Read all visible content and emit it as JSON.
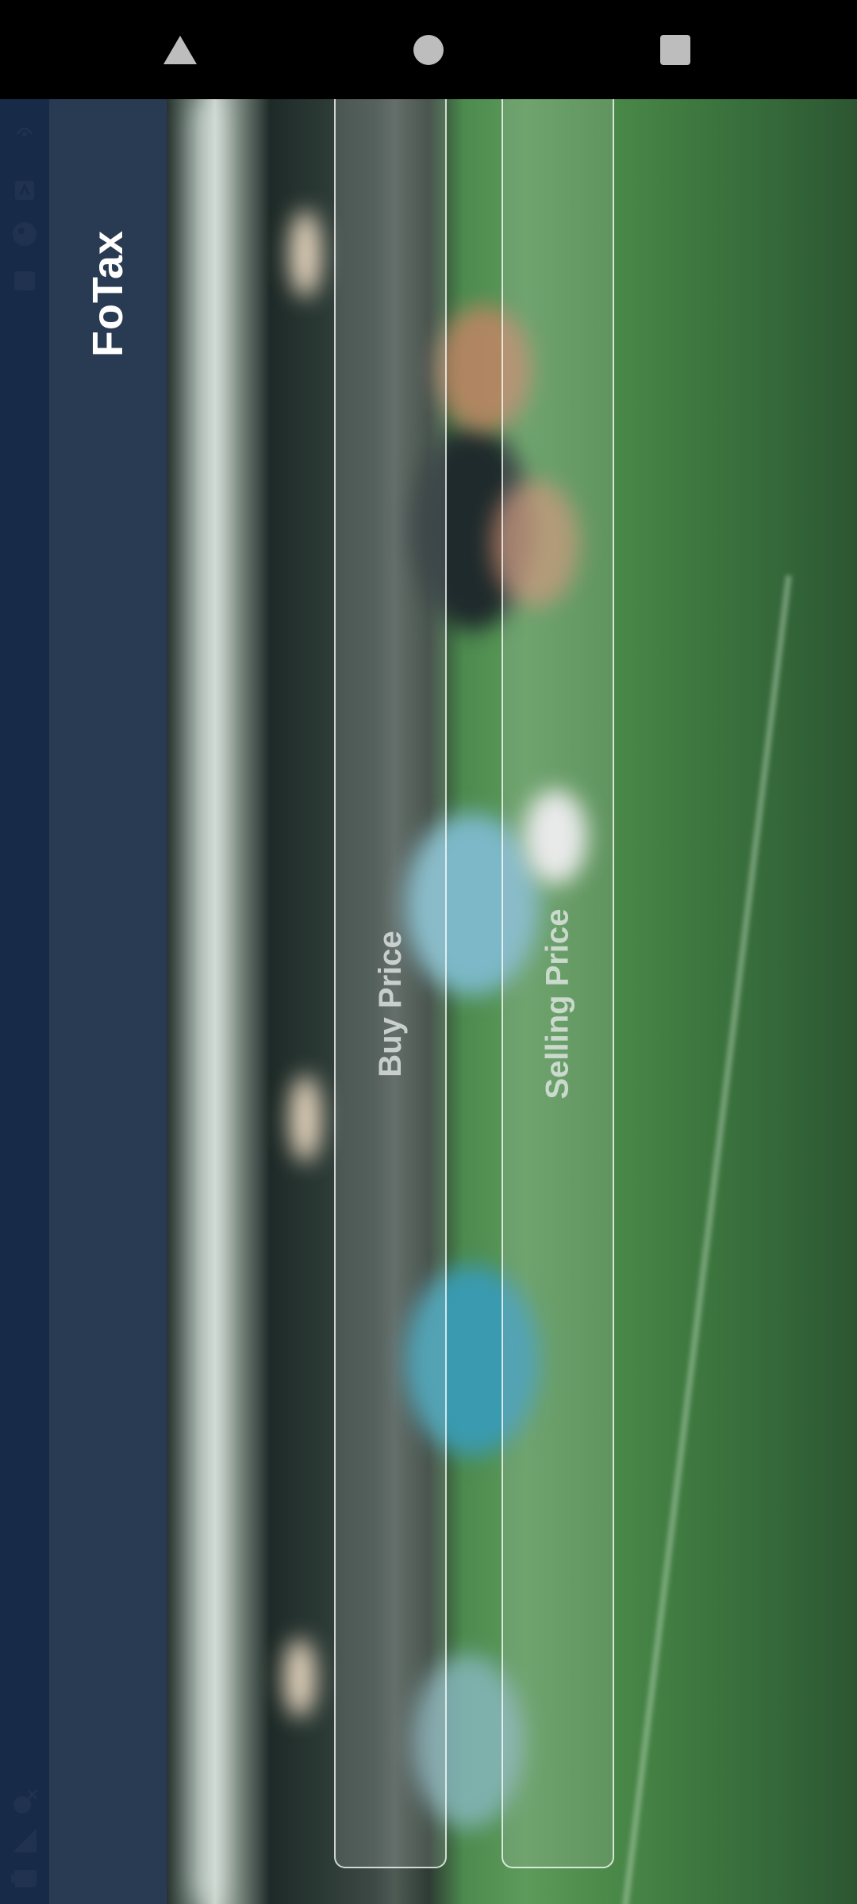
{
  "app": {
    "title": "FoTax"
  },
  "form": {
    "buy_price_label": "Buy Price",
    "selling_price_label": "Selling Price"
  },
  "navigation": {
    "back_icon": "triangle-back-icon",
    "home_icon": "circle-home-icon",
    "recents_icon": "square-recents-icon"
  },
  "status_bar": {
    "icons": [
      "wifi-icon",
      "notification-a-icon",
      "circle-app-icon",
      "message-icon",
      "no-sim-icon",
      "signal-icon",
      "battery-icon"
    ]
  },
  "colors": {
    "status_bar_bg": "#172a48",
    "app_bar_bg": "#293a53",
    "app_title": "#ffffff",
    "panel_border": "#ffffff"
  }
}
